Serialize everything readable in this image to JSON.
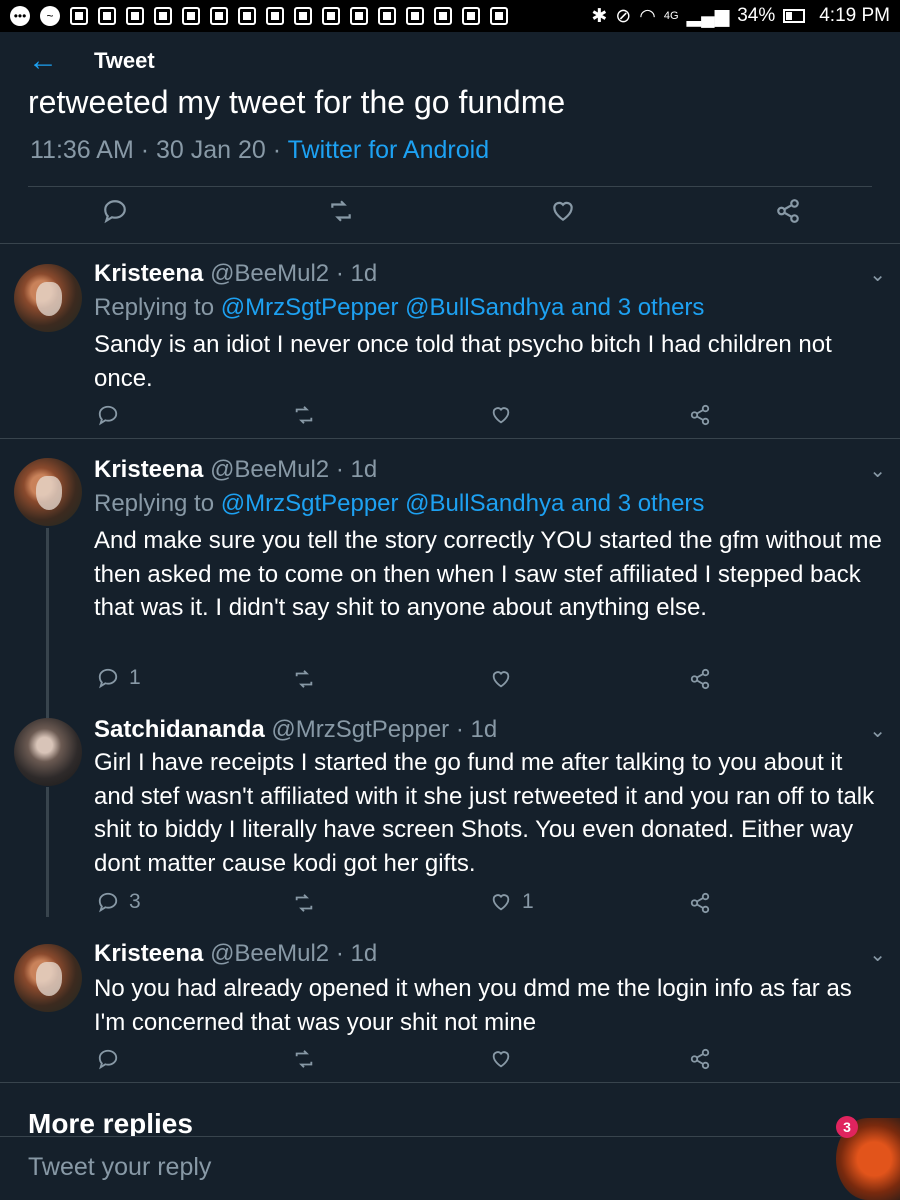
{
  "status_bar": {
    "network": "4G",
    "battery": "34%",
    "time": "4:19 PM"
  },
  "header": {
    "title": "Tweet"
  },
  "main_tweet": {
    "text_tail": "retweeted my tweet for the go fundme",
    "time": "11:36 AM",
    "date": "30 Jan 20",
    "source": "Twitter for Android"
  },
  "replies": [
    {
      "name": "Kristeena",
      "handle": "@BeeMul2",
      "age": "1d",
      "replying_prefix": "Replying to",
      "mentions": "@MrzSgtPepper @BullSandhya and 3 others",
      "text": "Sandy is an idiot I never once told that psycho bitch I had children not once.",
      "reply_count": "",
      "like_count": ""
    },
    {
      "name": "Kristeena",
      "handle": "@BeeMul2",
      "age": "1d",
      "replying_prefix": "Replying to",
      "mentions": "@MrzSgtPepper @BullSandhya and 3 others",
      "text": "And make sure you tell the story correctly YOU started the gfm without me then asked me to come on then when I saw stef affiliated I stepped back that was it. I didn't say shit to anyone about anything else.",
      "reply_count": "1",
      "like_count": ""
    },
    {
      "name": "Satchidananda",
      "handle": "@MrzSgtPepper",
      "age": "1d",
      "text": "Girl I have receipts I started the go fund me after talking to you about it and stef wasn't affiliated with it she just retweeted it and you ran off to talk shit to biddy I literally have screen Shots. You even donated. Either way dont matter cause kodi got her gifts.",
      "reply_count": "3",
      "like_count": "1"
    },
    {
      "name": "Kristeena",
      "handle": "@BeeMul2",
      "age": "1d",
      "text": "No you had already opened it when you dmd me the login info as far as I'm concerned that was your shit not mine",
      "reply_count": "",
      "like_count": ""
    }
  ],
  "more_replies": "More replies",
  "reply_box": {
    "placeholder": "Tweet your reply"
  },
  "fab_badge": "3",
  "icons": {
    "reply": "reply-icon",
    "retweet": "retweet-icon",
    "like": "heart-icon",
    "share": "share-icon",
    "back": "back-arrow-icon",
    "menu": "chevron-down-icon"
  },
  "colors": {
    "background": "#15202b",
    "accent": "#1da1f2",
    "muted": "#8899a6",
    "divider": "#38444d"
  }
}
